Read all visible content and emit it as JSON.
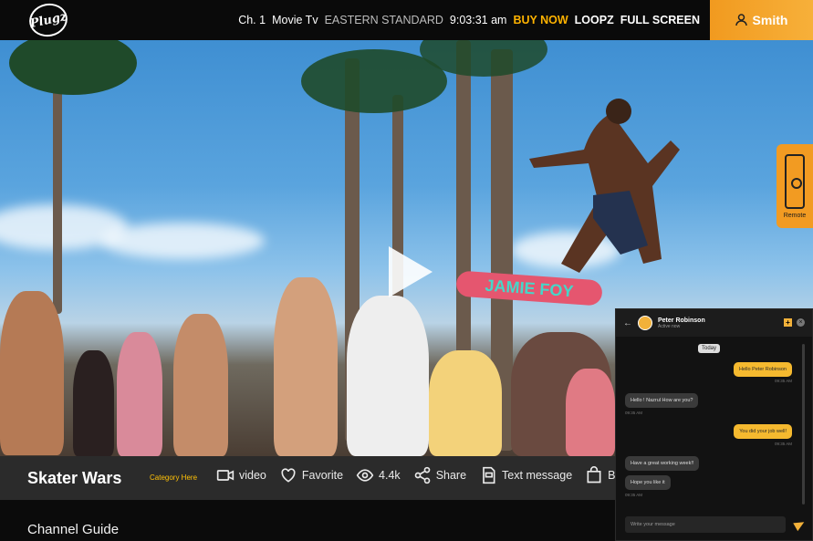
{
  "header": {
    "logo_text": "Plugz",
    "channel": "Ch. 1",
    "channel_name": "Movie Tv",
    "timezone": "EASTERN STANDARD",
    "time": "9:03:31 am",
    "buy_now": "BUY NOW",
    "loopz": "LOOPZ",
    "full_screen": "FULL SCREEN",
    "user_name": "Smith",
    "accent": "#f5a623"
  },
  "video": {
    "board_text": "JAMIE FOY"
  },
  "remote": {
    "label": "Remote"
  },
  "info": {
    "title": "Skater Wars",
    "category": "Category Here",
    "actions": [
      {
        "icon": "video-icon",
        "label": "video"
      },
      {
        "icon": "heart-icon",
        "label": "Favorite"
      },
      {
        "icon": "eye-icon",
        "label": "4.4k"
      },
      {
        "icon": "share-icon",
        "label": "Share"
      },
      {
        "icon": "sms-icon",
        "label": "Text message"
      },
      {
        "icon": "bag-icon",
        "label": "B"
      }
    ]
  },
  "channel_guide": "Channel Guide",
  "chat": {
    "name": "Peter Robinson",
    "status": "Active now",
    "today": "Today",
    "messages": [
      {
        "dir": "out",
        "text": "Hello Peter Robinson",
        "time": "09:35 AM"
      },
      {
        "dir": "in",
        "text": "Hello ! Nazrul How are you?",
        "time": "09:35 AM"
      },
      {
        "dir": "out",
        "text": "You did your job well!",
        "time": "09:35 AM"
      },
      {
        "dir": "in",
        "text": "Have a great working week!!",
        "time": ""
      },
      {
        "dir": "in",
        "text": "Hope you like it",
        "time": "09:35 AM"
      }
    ],
    "input_placeholder": "Write your message"
  }
}
